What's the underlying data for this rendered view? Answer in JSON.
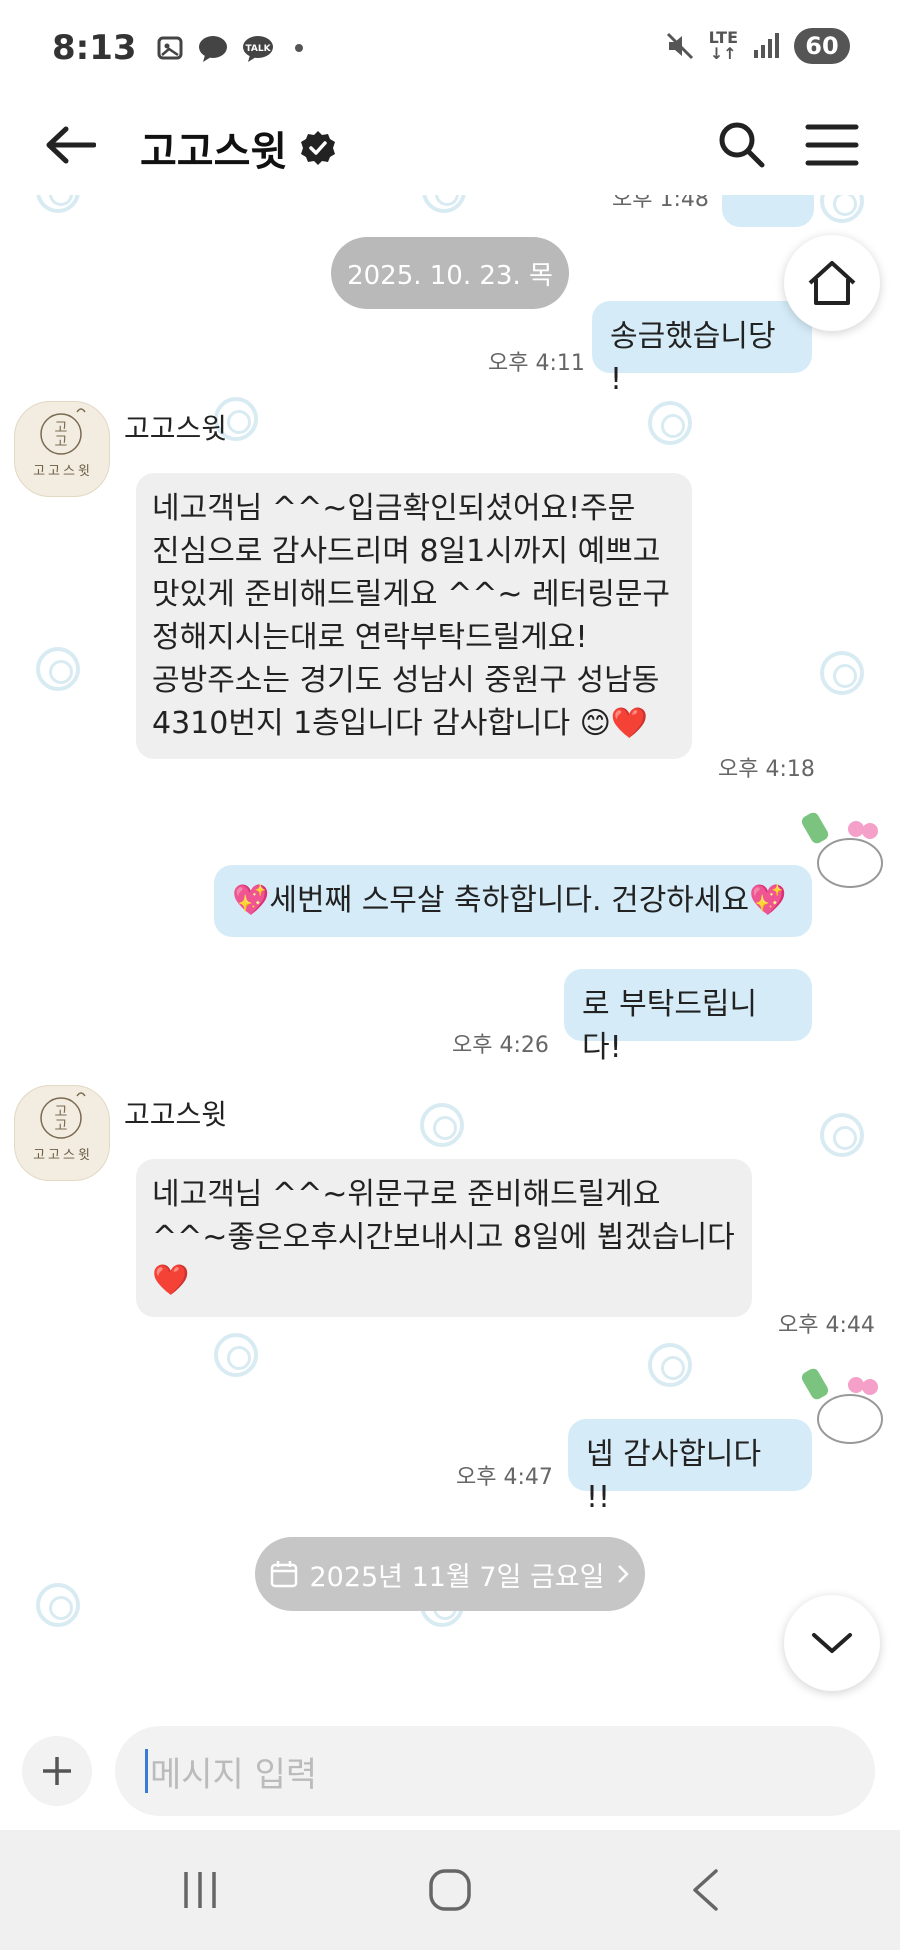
{
  "status_bar": {
    "time": "8:13",
    "network": "LTE",
    "battery": "60"
  },
  "header": {
    "title": "고고스윗"
  },
  "chat": {
    "partial_top_time": "오후 1:48",
    "date_divider": "2025. 10. 23. 목",
    "messages": [
      {
        "id": "m1",
        "text": "송금했습니당 !",
        "time": "오후 4:11"
      },
      {
        "id": "m2",
        "sender": "고고스윗",
        "lines": [
          "네고객님 ^^~입금확인되셨어요!주문",
          "진심으로 감사드리며 8일1시까지 예쁘고",
          "맛있게 준비해드릴게요 ^^~ 레터링문구",
          "정해지시는대로 연락부탁드릴게요!",
          "공방주소는 경기도 성남시 중원구 성남동",
          "4310번지 1층입니다 감사합니다 😊❤️"
        ],
        "time": "오후 4:18"
      },
      {
        "id": "m3",
        "text": "💖세번째 스무살 축하합니다. 건강하세요💖"
      },
      {
        "id": "m4",
        "text": "로 부탁드립니다!",
        "time": "오후 4:26"
      },
      {
        "id": "m5",
        "sender": "고고스윗",
        "lines": [
          "네고객님 ^^~위문구로 준비해드릴게요",
          "^^~좋은오후시간보내시고 8일에 뵙겠습니다",
          "❤️"
        ],
        "time": "오후 4:44"
      },
      {
        "id": "m6",
        "text": "넵 감사합니다 !!",
        "time": "오후 4:47"
      }
    ],
    "avatar_text": "고고스윗",
    "schedule_chip": "2025년 11월 7일 금요일"
  },
  "input": {
    "placeholder": "메시지 입력"
  },
  "icons": {
    "back": "back-arrow-icon",
    "search": "search-icon",
    "menu": "hamburger-menu-icon",
    "home": "home-icon",
    "scroll_down": "chevron-down-icon",
    "plus": "plus-icon",
    "calendar": "calendar-icon"
  },
  "colors": {
    "outgoing_bubble": "#d5ecf8",
    "incoming_bubble": "#efefef",
    "date_chip": "#b9b9b9"
  }
}
